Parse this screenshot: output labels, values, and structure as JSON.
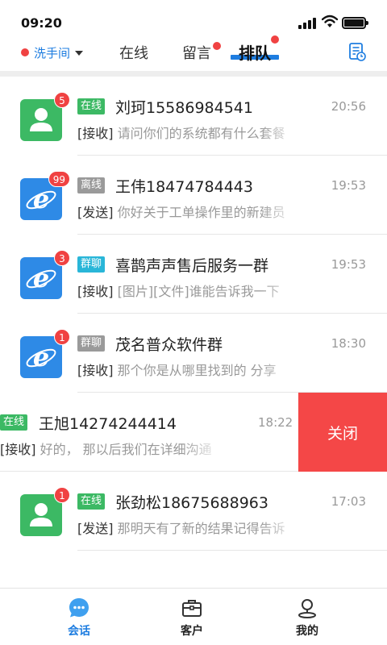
{
  "status_bar": {
    "time": "09:20"
  },
  "header": {
    "location": "洗手间",
    "tabs": [
      {
        "label": "在线"
      },
      {
        "label": "留言"
      },
      {
        "label": "排队"
      }
    ]
  },
  "conversations": [
    {
      "tag": "在线",
      "name": "刘珂15586984541",
      "time": "20:56",
      "direction": "[接收]",
      "preview": "请问你们的系统都有什么套餐",
      "badge": "5"
    },
    {
      "tag": "离线",
      "name": "王伟18474784443",
      "time": "19:53",
      "direction": "[发送]",
      "preview": "你好关于工单操作里的新建员",
      "badge": "99"
    },
    {
      "tag": "群聊",
      "name": "喜鹊声声售后服务一群",
      "time": "19:53",
      "direction": "[接收]",
      "preview": "[图片][文件]谁能告诉我一下",
      "badge": "3"
    },
    {
      "tag": "群聊",
      "name": "茂名普众软件群",
      "time": "18:30",
      "direction": "[接收]",
      "preview": "那个你是从哪里找到的 分享",
      "badge": "1"
    },
    {
      "tag": "在线",
      "name": "王旭14274244414",
      "time": "18:22",
      "direction": "[接收]",
      "preview": "好的， 那以后我们在详细沟通",
      "action": "关闭"
    },
    {
      "tag": "在线",
      "name": "张劲松18675688963",
      "time": "17:03",
      "direction": "[发送]",
      "preview": "那明天有了新的结果记得告诉",
      "badge": "1"
    }
  ],
  "bottom_nav": [
    {
      "label": "会话"
    },
    {
      "label": "客户"
    },
    {
      "label": "我的"
    }
  ],
  "colors": {
    "accent": "#1e7de0",
    "badge": "#f04242",
    "online_tag": "#3cb964",
    "offline_tag": "#9a9a9a",
    "group_tag": "#29b6d8",
    "close_action": "#f44747"
  }
}
